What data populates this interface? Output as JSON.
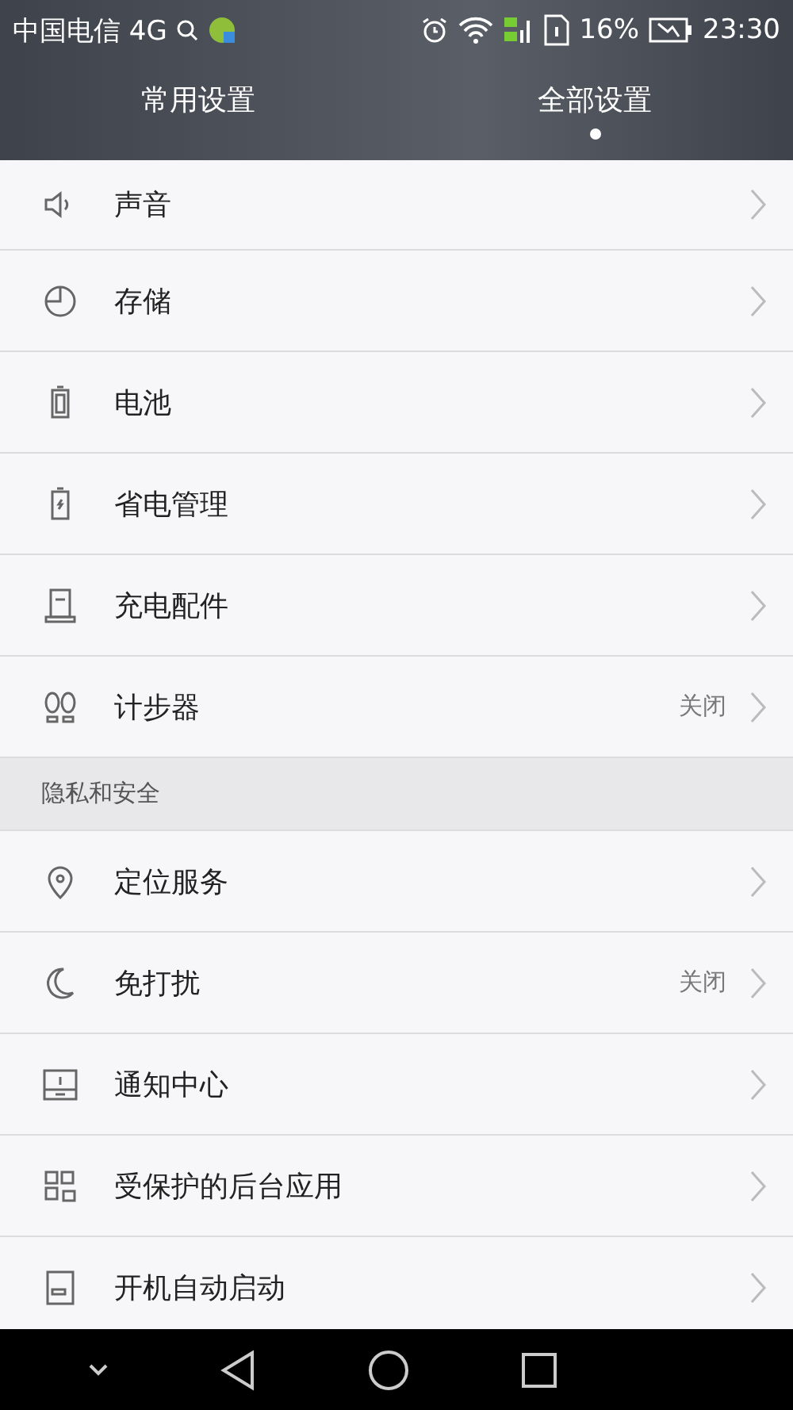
{
  "status_bar": {
    "carrier": "中国电信 4G",
    "battery": "16%",
    "time": "23:30"
  },
  "tabs": [
    {
      "label": "常用设置",
      "selected": false
    },
    {
      "label": "全部设置",
      "selected": true
    }
  ],
  "sections": [
    {
      "items": [
        {
          "label": "声音"
        },
        {
          "label": "存储"
        },
        {
          "label": "电池"
        },
        {
          "label": "省电管理"
        },
        {
          "label": "充电配件"
        },
        {
          "label": "计步器",
          "value": "关闭"
        }
      ]
    },
    {
      "header": "隐私和安全",
      "items": [
        {
          "label": "定位服务"
        },
        {
          "label": "免打扰",
          "value": "关闭"
        },
        {
          "label": "通知中心"
        },
        {
          "label": "受保护的后台应用"
        },
        {
          "label": "开机自动启动"
        }
      ]
    }
  ]
}
